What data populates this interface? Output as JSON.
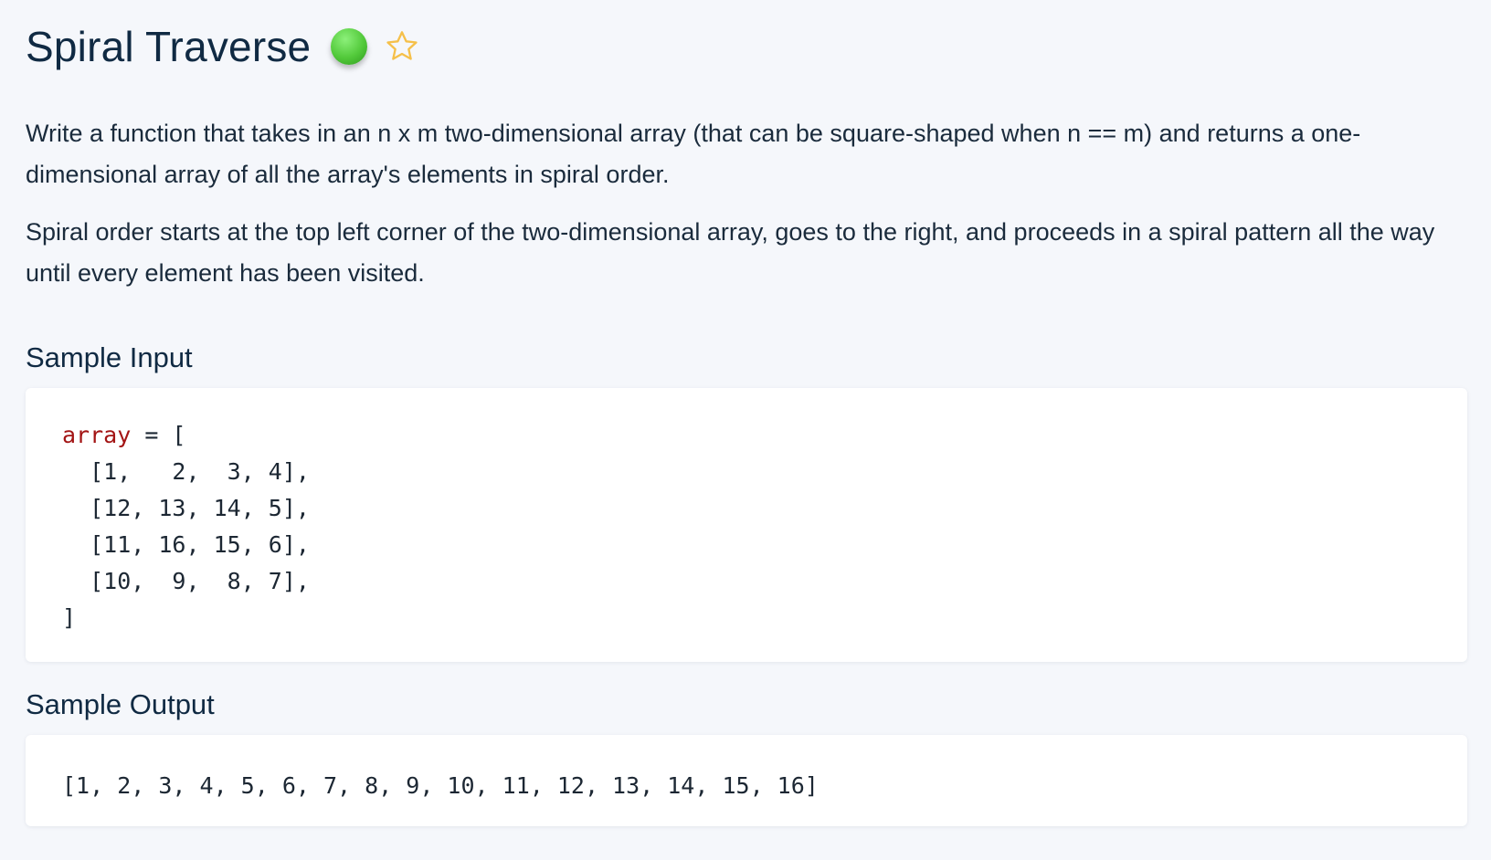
{
  "problem": {
    "title": "Spiral Traverse",
    "difficulty_color": "#52c93a",
    "favorite_icon": "star-outline-icon",
    "description": [
      "Write a function that takes in an n x m two-dimensional array (that can be square-shaped when n == m) and returns a one-dimensional array of all the array's elements in spiral order.",
      "Spiral order starts at the top left corner of the two-dimensional array, goes to the right, and proceeds in a spiral pattern all the way until every element has been visited."
    ]
  },
  "sample_input": {
    "label": "Sample Input",
    "variable": "array",
    "assignment": " = [",
    "rows": [
      "  [1,   2,  3, 4],",
      "  [12, 13, 14, 5],",
      "  [11, 16, 15, 6],",
      "  [10,  9,  8, 7],"
    ],
    "closing": "]"
  },
  "sample_output": {
    "label": "Sample Output",
    "value": "[1, 2, 3, 4, 5, 6, 7, 8, 9, 10, 11, 12, 13, 14, 15, 16]"
  },
  "colors": {
    "background": "#f5f7fb",
    "title": "#102a43",
    "keyword": "#a31515",
    "star": "#f5c04a"
  }
}
